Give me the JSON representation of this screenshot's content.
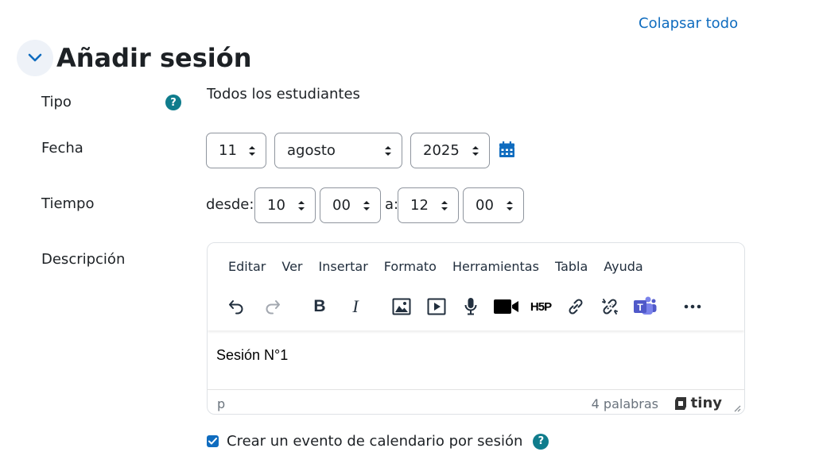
{
  "header": {
    "collapse_all": "Colapsar todo"
  },
  "section": {
    "title": "Añadir sesión"
  },
  "fields": {
    "tipo": {
      "label": "Tipo",
      "value": "Todos los estudiantes",
      "help": "?"
    },
    "fecha": {
      "label": "Fecha",
      "day": "11",
      "month": "agosto",
      "year": "2025"
    },
    "tiempo": {
      "label": "Tiempo",
      "from_label": "desde:",
      "from_hour": "10",
      "from_min": "00",
      "to_label": "a:",
      "to_hour": "12",
      "to_min": "00"
    },
    "descripcion": {
      "label": "Descripción"
    }
  },
  "editor": {
    "menu": [
      "Editar",
      "Ver",
      "Insertar",
      "Formato",
      "Herramientas",
      "Tabla",
      "Ayuda"
    ],
    "toolbar_icons": [
      "undo-icon",
      "redo-icon",
      "bold-icon",
      "italic-icon",
      "image-icon",
      "media-icon",
      "microphone-icon",
      "video-camera-icon",
      "h5p-icon",
      "link-icon",
      "unlink-icon",
      "teams-icon",
      "more-icon"
    ],
    "bold_glyph": "B",
    "italic_glyph": "I",
    "h5p_label": "H5P",
    "teams_letter": "T",
    "content": "Sesión N°1",
    "status_element": "p",
    "word_count": "4 palabras",
    "brand": "tiny"
  },
  "calendar_event": {
    "label": "Crear un evento de calendario por sesión",
    "checked": true,
    "help": "?"
  },
  "colors": {
    "link": "#0f6cbf",
    "help": "#0f7c8c",
    "teams": "#5059c9"
  }
}
